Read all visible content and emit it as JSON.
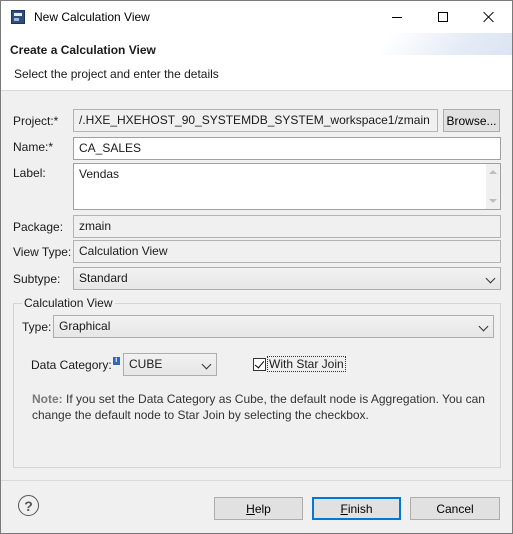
{
  "window": {
    "title": "New Calculation View",
    "controls": [
      "minimize-icon",
      "maximize-icon",
      "close-icon"
    ]
  },
  "header": {
    "title": "Create a Calculation View",
    "description": "Select the project and enter the details"
  },
  "form": {
    "project": {
      "label": "Project:*",
      "value": "/.HXE_HXEHOST_90_SYSTEMDB_SYSTEM_workspace1/zmain",
      "browse": "Browse..."
    },
    "name": {
      "label": "Name:*",
      "value": "CA_SALES"
    },
    "label": {
      "label": "Label:",
      "value": "Vendas"
    },
    "package": {
      "label": "Package:",
      "value": "zmain"
    },
    "view_type": {
      "label": "View Type:",
      "value": "Calculation View"
    },
    "subtype": {
      "label": "Subtype:",
      "value": "Standard"
    }
  },
  "calc_view": {
    "group_title": "Calculation View",
    "type": {
      "label": "Type:",
      "value": "Graphical"
    },
    "data_category": {
      "label": "Data Category:",
      "info": "i",
      "value": "CUBE"
    },
    "star_join": {
      "label": "With Star Join",
      "checked": true
    },
    "note": {
      "label": "Note:",
      "text": "If you set the Data Category as Cube, the default node is Aggregation. You can change the default node to Star Join by selecting the checkbox."
    }
  },
  "footer": {
    "help_icon": "?",
    "help_button": "Help",
    "finish_button": "Finish",
    "cancel_button": "Cancel"
  }
}
